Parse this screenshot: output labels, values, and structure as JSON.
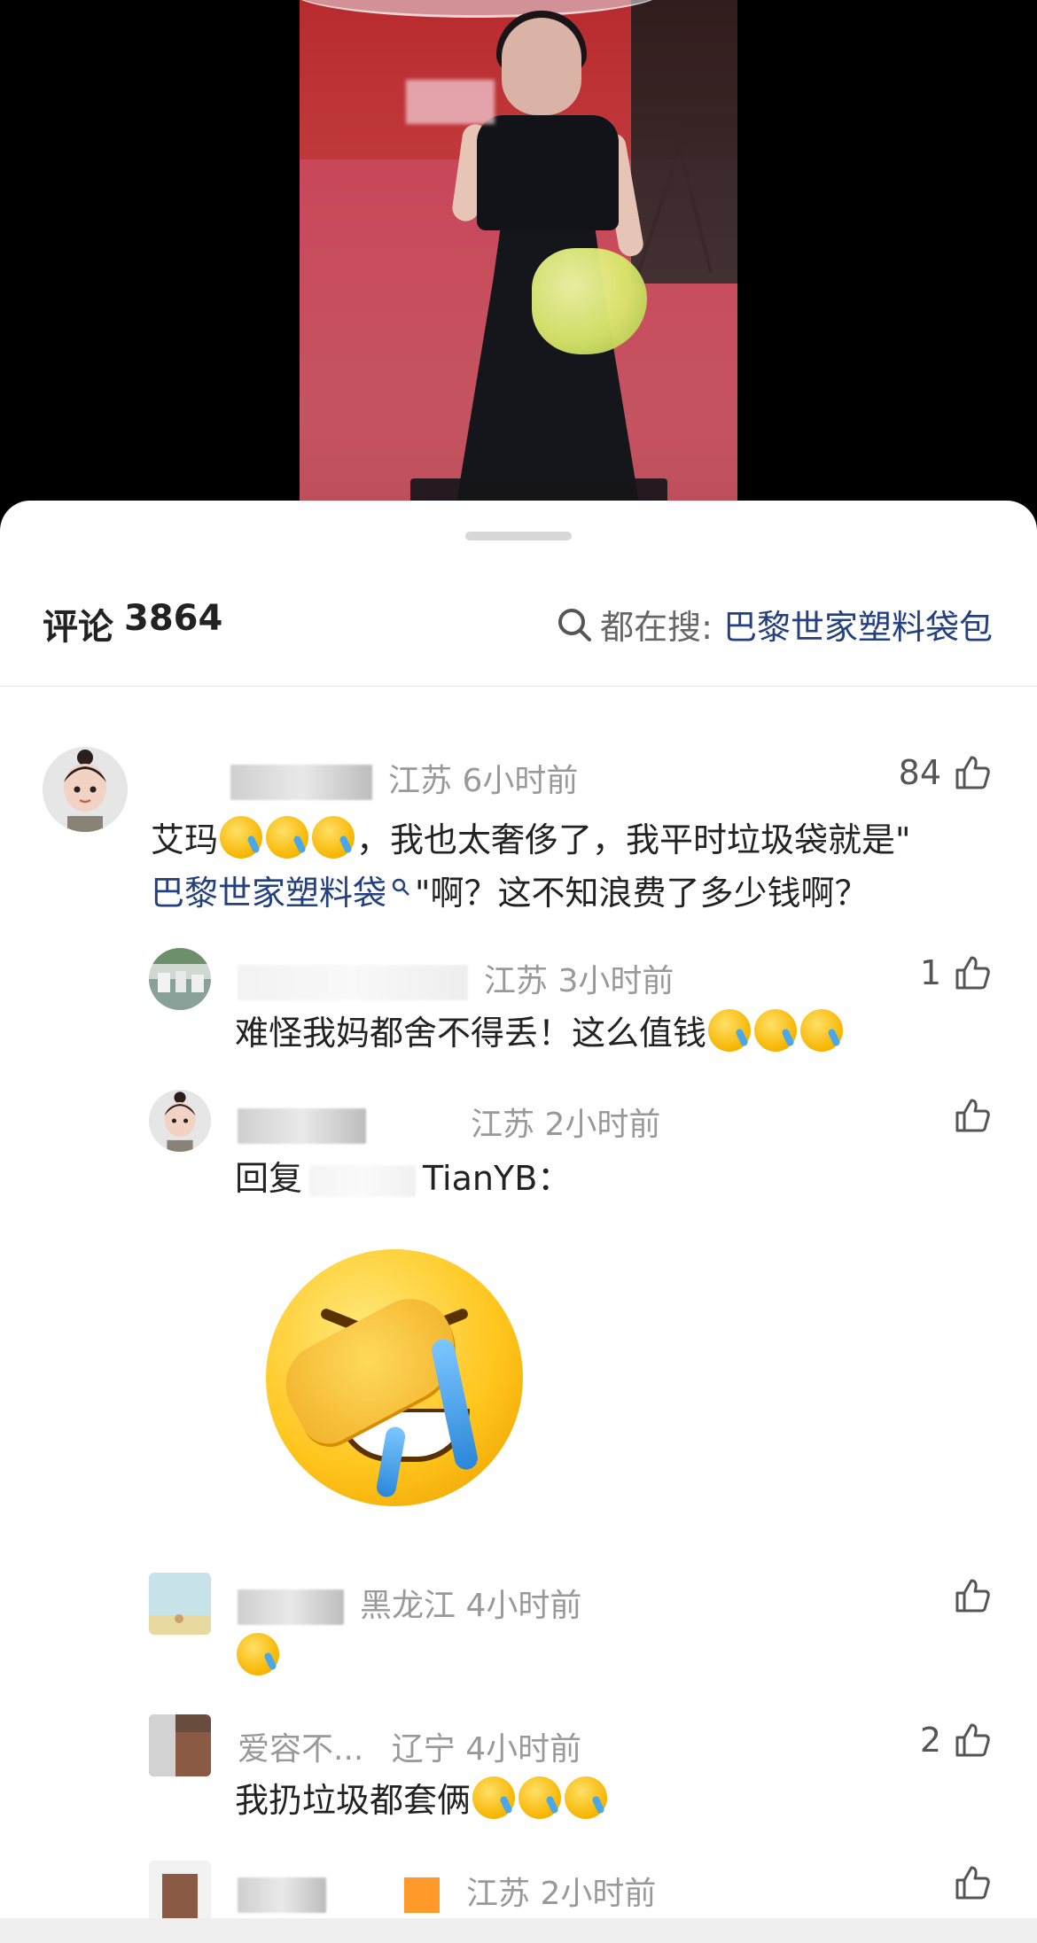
{
  "sheet": {
    "comment_label": "评论",
    "comment_count": "3864",
    "hot_search_label": "都在搜:",
    "hot_search_term": "巴黎世家塑料袋包"
  },
  "comments": [
    {
      "location": "江苏",
      "time": "6小时前",
      "likes": "84",
      "text_before": "艾玛",
      "text_after": "，我也太奢侈了，我平时垃圾袋就是\"",
      "link_text": "巴黎世家塑料袋",
      "text_tail": "\"啊？这不知浪费了多少钱啊？"
    },
    {
      "location": "江苏",
      "time": "3小时前",
      "likes": "1",
      "text": "难怪我妈都舍不得丢！这么值钱"
    },
    {
      "location": "江苏",
      "time": "2小时前",
      "likes": "",
      "reply_prefix": "回复",
      "reply_target": "TianYB：",
      "sticker": "face-with-hand-over-mouth-crying-laughing"
    },
    {
      "location": "黑龙江",
      "time": "4小时前",
      "likes": ""
    },
    {
      "username": "爱容不...",
      "location": "辽宁",
      "time": "4小时前",
      "likes": "2",
      "text": "我扔垃圾都套俩"
    },
    {
      "location": "江苏",
      "time": "2小时前",
      "likes": ""
    }
  ],
  "icons": {
    "search": "search-icon",
    "like": "thumbs-up-icon",
    "emoji": "crying-laughing-emoji"
  },
  "colors": {
    "link": "#24407f",
    "meta": "#999999",
    "sheet_bg": "#ffffff"
  }
}
